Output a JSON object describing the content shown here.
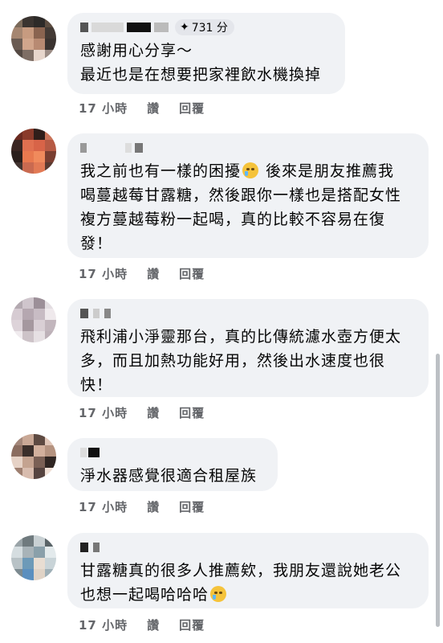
{
  "comments": [
    {
      "text": "感謝用心分享～\n最近也是在想要把家裡飲水機換掉",
      "badge": "731 分",
      "time": "17 小時",
      "like": "讚",
      "reply": "回覆"
    },
    {
      "text_a": "我之前也有一樣的困擾",
      "text_b": " 後來是朋友推薦我\n喝蔓越莓甘露糖，然後跟你一樣也是搭配女性\n複方蔓越莓粉一起喝，真的比較不容易在復\n發！",
      "emoji": "crying-face-icon",
      "time": "17 小時",
      "like": "讚",
      "reply": "回覆"
    },
    {
      "text": "飛利浦小淨靈那台，真的比傳統濾水壺方便太\n多，而且加熱功能好用，然後出水速度也很\n快！",
      "time": "17 小時",
      "like": "讚",
      "reply": "回覆"
    },
    {
      "text": "淨水器感覺很適合租屋族",
      "time": "17 小時",
      "like": "讚",
      "reply": "回覆"
    },
    {
      "text_a": "甘露糖真的很多人推薦欸，我朋友還說她老公\n也想一起喝哈哈哈",
      "emoji": "laughing-tears-icon",
      "time": "17 小時",
      "like": "讚",
      "reply": "回覆"
    }
  ],
  "colors": {
    "bubble": "#f0f2f5",
    "action_text": "#65676b",
    "badge_bg": "#e4e6eb"
  }
}
